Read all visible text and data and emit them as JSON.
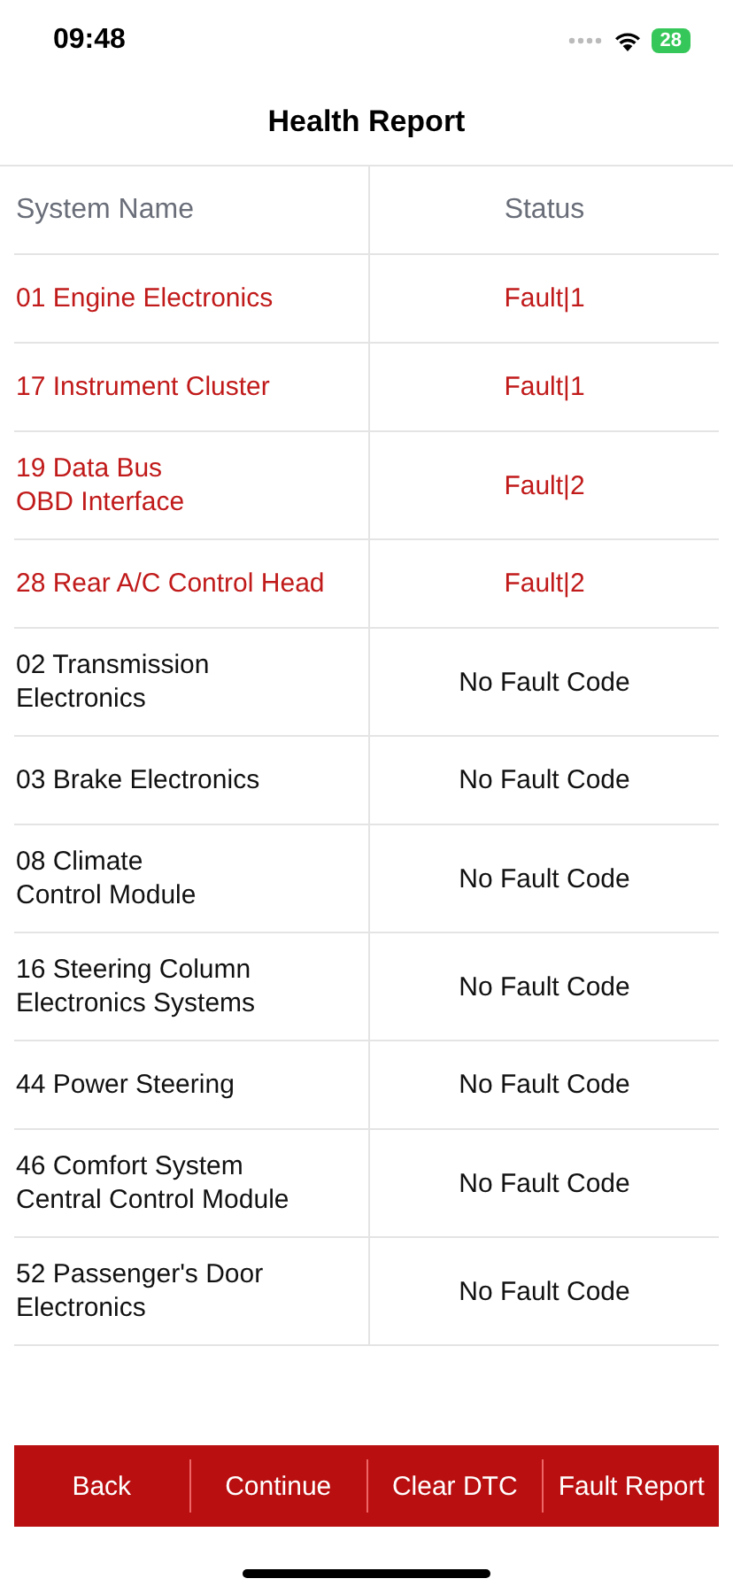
{
  "status_bar": {
    "time": "09:48",
    "battery": "28"
  },
  "title": "Health Report",
  "table": {
    "columns": [
      "System Name",
      "Status"
    ],
    "rows": [
      {
        "name": "01 Engine Electronics",
        "status": "Fault|1",
        "fault": true
      },
      {
        "name": "17 Instrument Cluster",
        "status": "Fault|1",
        "fault": true
      },
      {
        "name": "19 Data Bus\nOBD Interface",
        "status": "Fault|2",
        "fault": true
      },
      {
        "name": "28 Rear A/C Control Head",
        "status": "Fault|2",
        "fault": true
      },
      {
        "name": "02 Transmission\nElectronics",
        "status": "No Fault Code",
        "fault": false
      },
      {
        "name": "03 Brake Electronics",
        "status": "No Fault Code",
        "fault": false
      },
      {
        "name": "08 Climate\nControl Module",
        "status": "No Fault Code",
        "fault": false
      },
      {
        "name": "16 Steering Column\nElectronics Systems",
        "status": "No Fault Code",
        "fault": false
      },
      {
        "name": "44 Power Steering",
        "status": "No Fault Code",
        "fault": false
      },
      {
        "name": "46 Comfort System\nCentral Control Module",
        "status": "No Fault Code",
        "fault": false
      },
      {
        "name": "52 Passenger's Door\nElectronics",
        "status": "No Fault Code",
        "fault": false
      }
    ]
  },
  "buttons": [
    "Back",
    "Continue",
    "Clear DTC",
    "Fault Report"
  ]
}
